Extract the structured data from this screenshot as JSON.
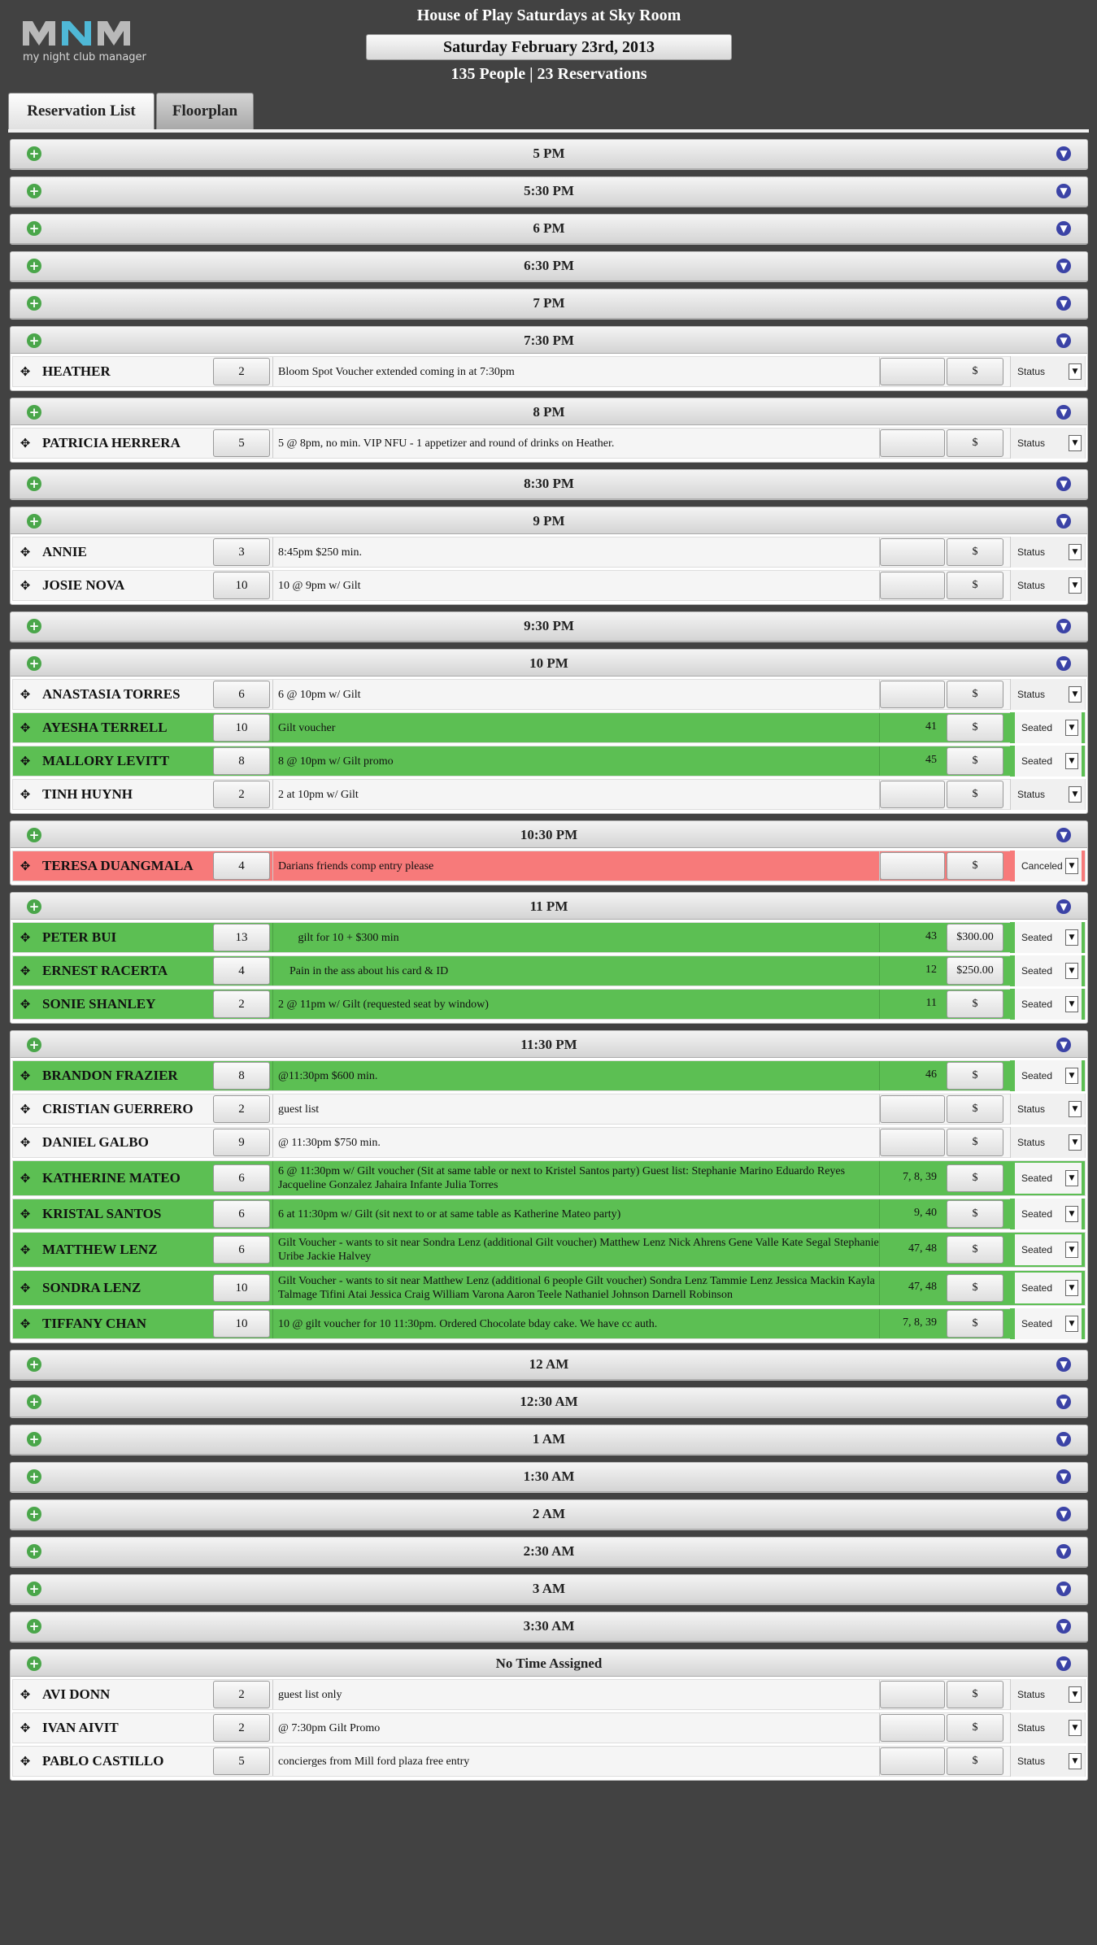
{
  "app": {
    "logo_text": "my night club manager",
    "venue_title": "House of Play Saturdays at Sky Room",
    "date": "Saturday February 23rd, 2013",
    "summary": "135 People | 23 Reservations"
  },
  "tabs": [
    {
      "label": "Reservation List",
      "active": true
    },
    {
      "label": "Floorplan",
      "active": false
    }
  ],
  "colors": {
    "seated": "#5cbf53",
    "canceled": "#f77a7a",
    "add": "#4aa64a",
    "expand": "#3b43a6"
  },
  "icons": {
    "add": "plus-circle-icon",
    "expand": "arrow-down-circle-icon",
    "drag": "move-icon"
  },
  "slots": [
    {
      "time": "5 PM",
      "reservations": []
    },
    {
      "time": "5:30 PM",
      "reservations": []
    },
    {
      "time": "6 PM",
      "reservations": []
    },
    {
      "time": "6:30 PM",
      "reservations": []
    },
    {
      "time": "7 PM",
      "reservations": []
    },
    {
      "time": "7:30 PM",
      "reservations": [
        {
          "name": "HEATHER",
          "party": "2",
          "notes": "Bloom Spot Voucher extended coming in at 7:30pm",
          "table": "",
          "min": "$",
          "status": "Status",
          "state": "none"
        }
      ]
    },
    {
      "time": "8 PM",
      "reservations": [
        {
          "name": "PATRICIA HERRERA",
          "party": "5",
          "notes": "5 @ 8pm, no min. VIP NFU - 1 appetizer and round of drinks on Heather.",
          "table": "",
          "min": "$",
          "status": "Status",
          "state": "none"
        }
      ]
    },
    {
      "time": "8:30 PM",
      "reservations": []
    },
    {
      "time": "9 PM",
      "reservations": [
        {
          "name": "ANNIE",
          "party": "3",
          "notes": "8:45pm $250 min.",
          "table": "",
          "min": "$",
          "status": "Status",
          "state": "none"
        },
        {
          "name": "JOSIE NOVA",
          "party": "10",
          "notes": "10 @ 9pm w/ Gilt",
          "table": "",
          "min": "$",
          "status": "Status",
          "state": "none"
        }
      ]
    },
    {
      "time": "9:30 PM",
      "reservations": []
    },
    {
      "time": "10 PM",
      "reservations": [
        {
          "name": "ANASTASIA TORRES",
          "party": "6",
          "notes": "6 @ 10pm w/ Gilt",
          "table": "",
          "min": "$",
          "status": "Status",
          "state": "none"
        },
        {
          "name": "AYESHA TERRELL",
          "party": "10",
          "notes": "Gilt voucher",
          "table": "41",
          "min": "$",
          "status": "Seated",
          "state": "seated"
        },
        {
          "name": "MALLORY LEVITT",
          "party": "8",
          "notes": "8 @ 10pm w/ Gilt promo",
          "table": "45",
          "min": "$",
          "status": "Seated",
          "state": "seated"
        },
        {
          "name": "TINH HUYNH",
          "party": "2",
          "notes": "2 at 10pm w/ Gilt",
          "table": "",
          "min": "$",
          "status": "Status",
          "state": "none"
        }
      ]
    },
    {
      "time": "10:30 PM",
      "reservations": [
        {
          "name": "TERESA DUANGMALA",
          "party": "4",
          "notes": "Darians friends comp entry please",
          "table": "",
          "min": "$",
          "status": "Canceled",
          "state": "canceled"
        }
      ]
    },
    {
      "time": "11 PM",
      "reservations": [
        {
          "name": "PETER BUI",
          "party": "13",
          "notes": "       gilt for 10 + $300 min",
          "table": "43",
          "min": "$300.00",
          "status": "Seated",
          "state": "seated"
        },
        {
          "name": "ERNEST RACERTA",
          "party": "4",
          "notes": "    Pain in the ass about his card & ID",
          "table": "12",
          "min": "$250.00",
          "status": "Seated",
          "state": "seated"
        },
        {
          "name": "SONIE SHANLEY",
          "party": "2",
          "notes": "2 @ 11pm w/ Gilt (requested seat by window)",
          "table": "11",
          "min": "$",
          "status": "Seated",
          "state": "seated"
        }
      ]
    },
    {
      "time": "11:30 PM",
      "reservations": [
        {
          "name": "BRANDON FRAZIER",
          "party": "8",
          "notes": "@11:30pm $600 min.",
          "table": "46",
          "min": "$",
          "status": "Seated",
          "state": "seated"
        },
        {
          "name": "CRISTIAN GUERRERO",
          "party": "2",
          "notes": "guest list",
          "table": "",
          "min": "$",
          "status": "Status",
          "state": "none"
        },
        {
          "name": "DANIEL GALBO",
          "party": "9",
          "notes": "@ 11:30pm $750 min.",
          "table": "",
          "min": "$",
          "status": "Status",
          "state": "none"
        },
        {
          "name": "KATHERINE MATEO",
          "party": "6",
          "notes": "6 @ 11:30pm w/ Gilt voucher (Sit at same table or next to Kristel Santos party) Guest list: Stephanie Marino Eduardo Reyes Jacqueline Gonzalez Jahaira Infante Julia Torres",
          "table": "7, 8, 39",
          "min": "$",
          "status": "Seated",
          "state": "seated",
          "tall": true
        },
        {
          "name": "KRISTAL SANTOS",
          "party": "6",
          "notes": "6 at 11:30pm w/ Gilt (sit next to or at same table as Katherine Mateo party)",
          "table": "9, 40",
          "min": "$",
          "status": "Seated",
          "state": "seated"
        },
        {
          "name": "MATTHEW LENZ",
          "party": "6",
          "notes": "Gilt Voucher - wants to sit near Sondra Lenz (additional Gilt voucher) Matthew Lenz Nick Ahrens Gene Valle Kate Segal Stephanie Uribe Jackie Halvey",
          "table": "47, 48",
          "min": "$",
          "status": "Seated",
          "state": "seated",
          "tall": true
        },
        {
          "name": "SONDRA LENZ",
          "party": "10",
          "notes": "Gilt Voucher - wants to sit near Matthew Lenz (additional 6 people Gilt voucher) Sondra Lenz Tammie Lenz Jessica Mackin Kayla Talmage Tifini Atai Jessica Craig William Varona Aaron Teele Nathaniel Johnson Darnell Robinson",
          "table": "47, 48",
          "min": "$",
          "status": "Seated",
          "state": "seated",
          "tall": true
        },
        {
          "name": "TIFFANY CHAN",
          "party": "10",
          "notes": "10 @ gilt voucher for 10 11:30pm. Ordered Chocolate bday cake. We have cc auth.",
          "table": "7, 8, 39",
          "min": "$",
          "status": "Seated",
          "state": "seated"
        }
      ]
    },
    {
      "time": "12 AM",
      "reservations": []
    },
    {
      "time": "12:30 AM",
      "reservations": []
    },
    {
      "time": "1 AM",
      "reservations": []
    },
    {
      "time": "1:30 AM",
      "reservations": []
    },
    {
      "time": "2 AM",
      "reservations": []
    },
    {
      "time": "2:30 AM",
      "reservations": []
    },
    {
      "time": "3 AM",
      "reservations": []
    },
    {
      "time": "3:30 AM",
      "reservations": []
    },
    {
      "time": "No Time Assigned",
      "reservations": [
        {
          "name": "AVI DONN",
          "party": "2",
          "notes": "guest list only",
          "table": "",
          "min": "$",
          "status": "Status",
          "state": "none"
        },
        {
          "name": "IVAN AIVIT",
          "party": "2",
          "notes": "@ 7:30pm Gilt Promo",
          "table": "",
          "min": "$",
          "status": "Status",
          "state": "none"
        },
        {
          "name": "PABLO CASTILLO",
          "party": "5",
          "notes": "concierges from Mill ford plaza free entry",
          "table": "",
          "min": "$",
          "status": "Status",
          "state": "none"
        }
      ]
    }
  ]
}
